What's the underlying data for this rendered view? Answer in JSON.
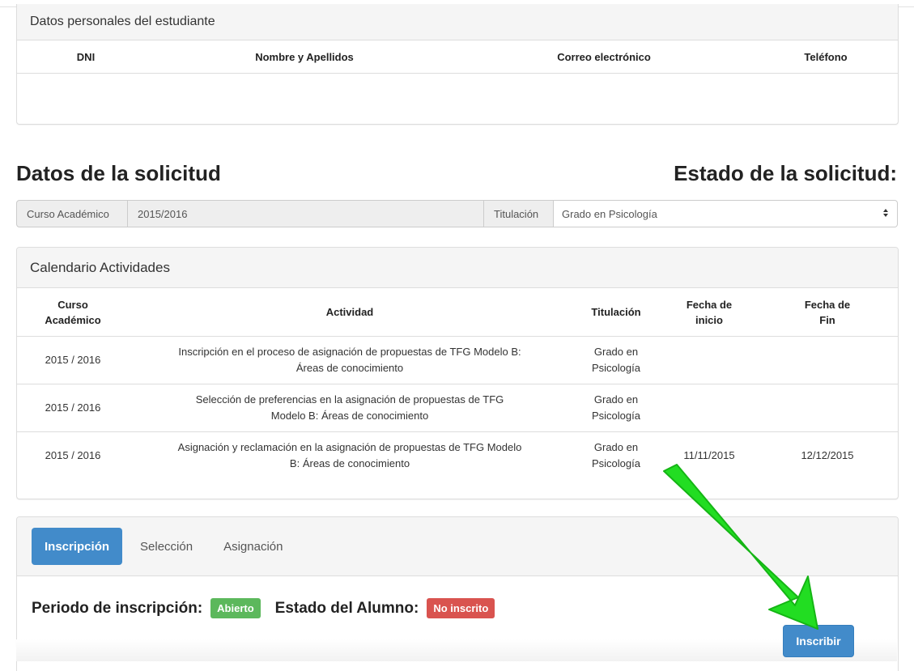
{
  "personal_panel": {
    "title": "Datos personales del estudiante",
    "columns": [
      "DNI",
      "Nombre y Apellidos",
      "Correo electrónico",
      "Teléfono"
    ]
  },
  "solicitud": {
    "title": "Datos de la solicitud",
    "estado_title": "Estado de la solicitud:",
    "curso_label": "Curso Académico",
    "curso_value": "2015/2016",
    "titulacion_label": "Titulación",
    "titulacion_selected": "Grado en Psicología",
    "select_icon": "updown-caret-icon"
  },
  "calendar": {
    "title": "Calendario Actividades",
    "headers": [
      "Curso\nAcadémico",
      "Actividad",
      "Titulación",
      "Fecha de\ninicio",
      "Fecha de\nFin"
    ],
    "rows": [
      {
        "curso": "2015 / 2016",
        "actividad": "Inscripción en el proceso de asignación de propuestas de TFG Modelo B: Áreas de conocimiento",
        "titulacion": "Grado en Psicología",
        "inicio": "",
        "fin": ""
      },
      {
        "curso": "2015 / 2016",
        "actividad": "Selección de preferencias en la asignación de propuestas de TFG Modelo B: Áreas de conocimiento",
        "titulacion": "Grado en Psicología",
        "inicio": "",
        "fin": ""
      },
      {
        "curso": "2015 / 2016",
        "actividad": "Asignación y reclamación en la asignación de propuestas de TFG Modelo B: Áreas de conocimiento",
        "titulacion": "Grado en Psicología",
        "inicio": "11/11/2015",
        "fin": "12/12/2015"
      }
    ]
  },
  "tabs": {
    "items": [
      {
        "label": "Inscripción",
        "active": true
      },
      {
        "label": "Selección",
        "active": false
      },
      {
        "label": "Asignación",
        "active": false
      }
    ]
  },
  "status": {
    "periodo_label": "Periodo de inscripción:",
    "periodo_badge": "Abierto",
    "alumno_label": "Estado del Alumno:",
    "alumno_badge": "No inscrito",
    "inscribir_button": "Inscribir"
  },
  "colors": {
    "primary": "#428bca",
    "success": "#5cb85c",
    "danger": "#d9534f",
    "annotation_arrow": "#22dd22"
  }
}
